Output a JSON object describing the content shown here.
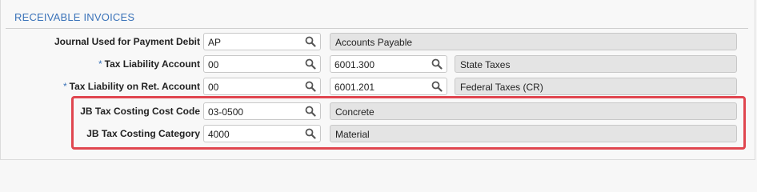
{
  "section": {
    "title": "RECEIVABLE INVOICES"
  },
  "rows": [
    {
      "label": "Journal Used for Payment Debit",
      "required": "",
      "code": "AP",
      "account": "",
      "description": "Accounts Payable"
    },
    {
      "label": "Tax Liability Account",
      "required": "*",
      "code": "00",
      "account": "6001.300",
      "description": "State Taxes"
    },
    {
      "label": "Tax Liability on Ret. Account",
      "required": "*",
      "code": "00",
      "account": "6001.201",
      "description": "Federal Taxes (CR)"
    },
    {
      "label": "JB Tax Costing Cost Code",
      "required": "",
      "code": "03-0500",
      "account": "",
      "description": "Concrete"
    },
    {
      "label": "JB Tax Costing Category",
      "required": "",
      "code": "4000",
      "account": "",
      "description": "Material"
    }
  ],
  "icons": {
    "lookup": "search-icon"
  },
  "colors": {
    "accent": "#3b73b9",
    "highlight": "#e0464f",
    "readonly_bg": "#e4e4e4"
  }
}
